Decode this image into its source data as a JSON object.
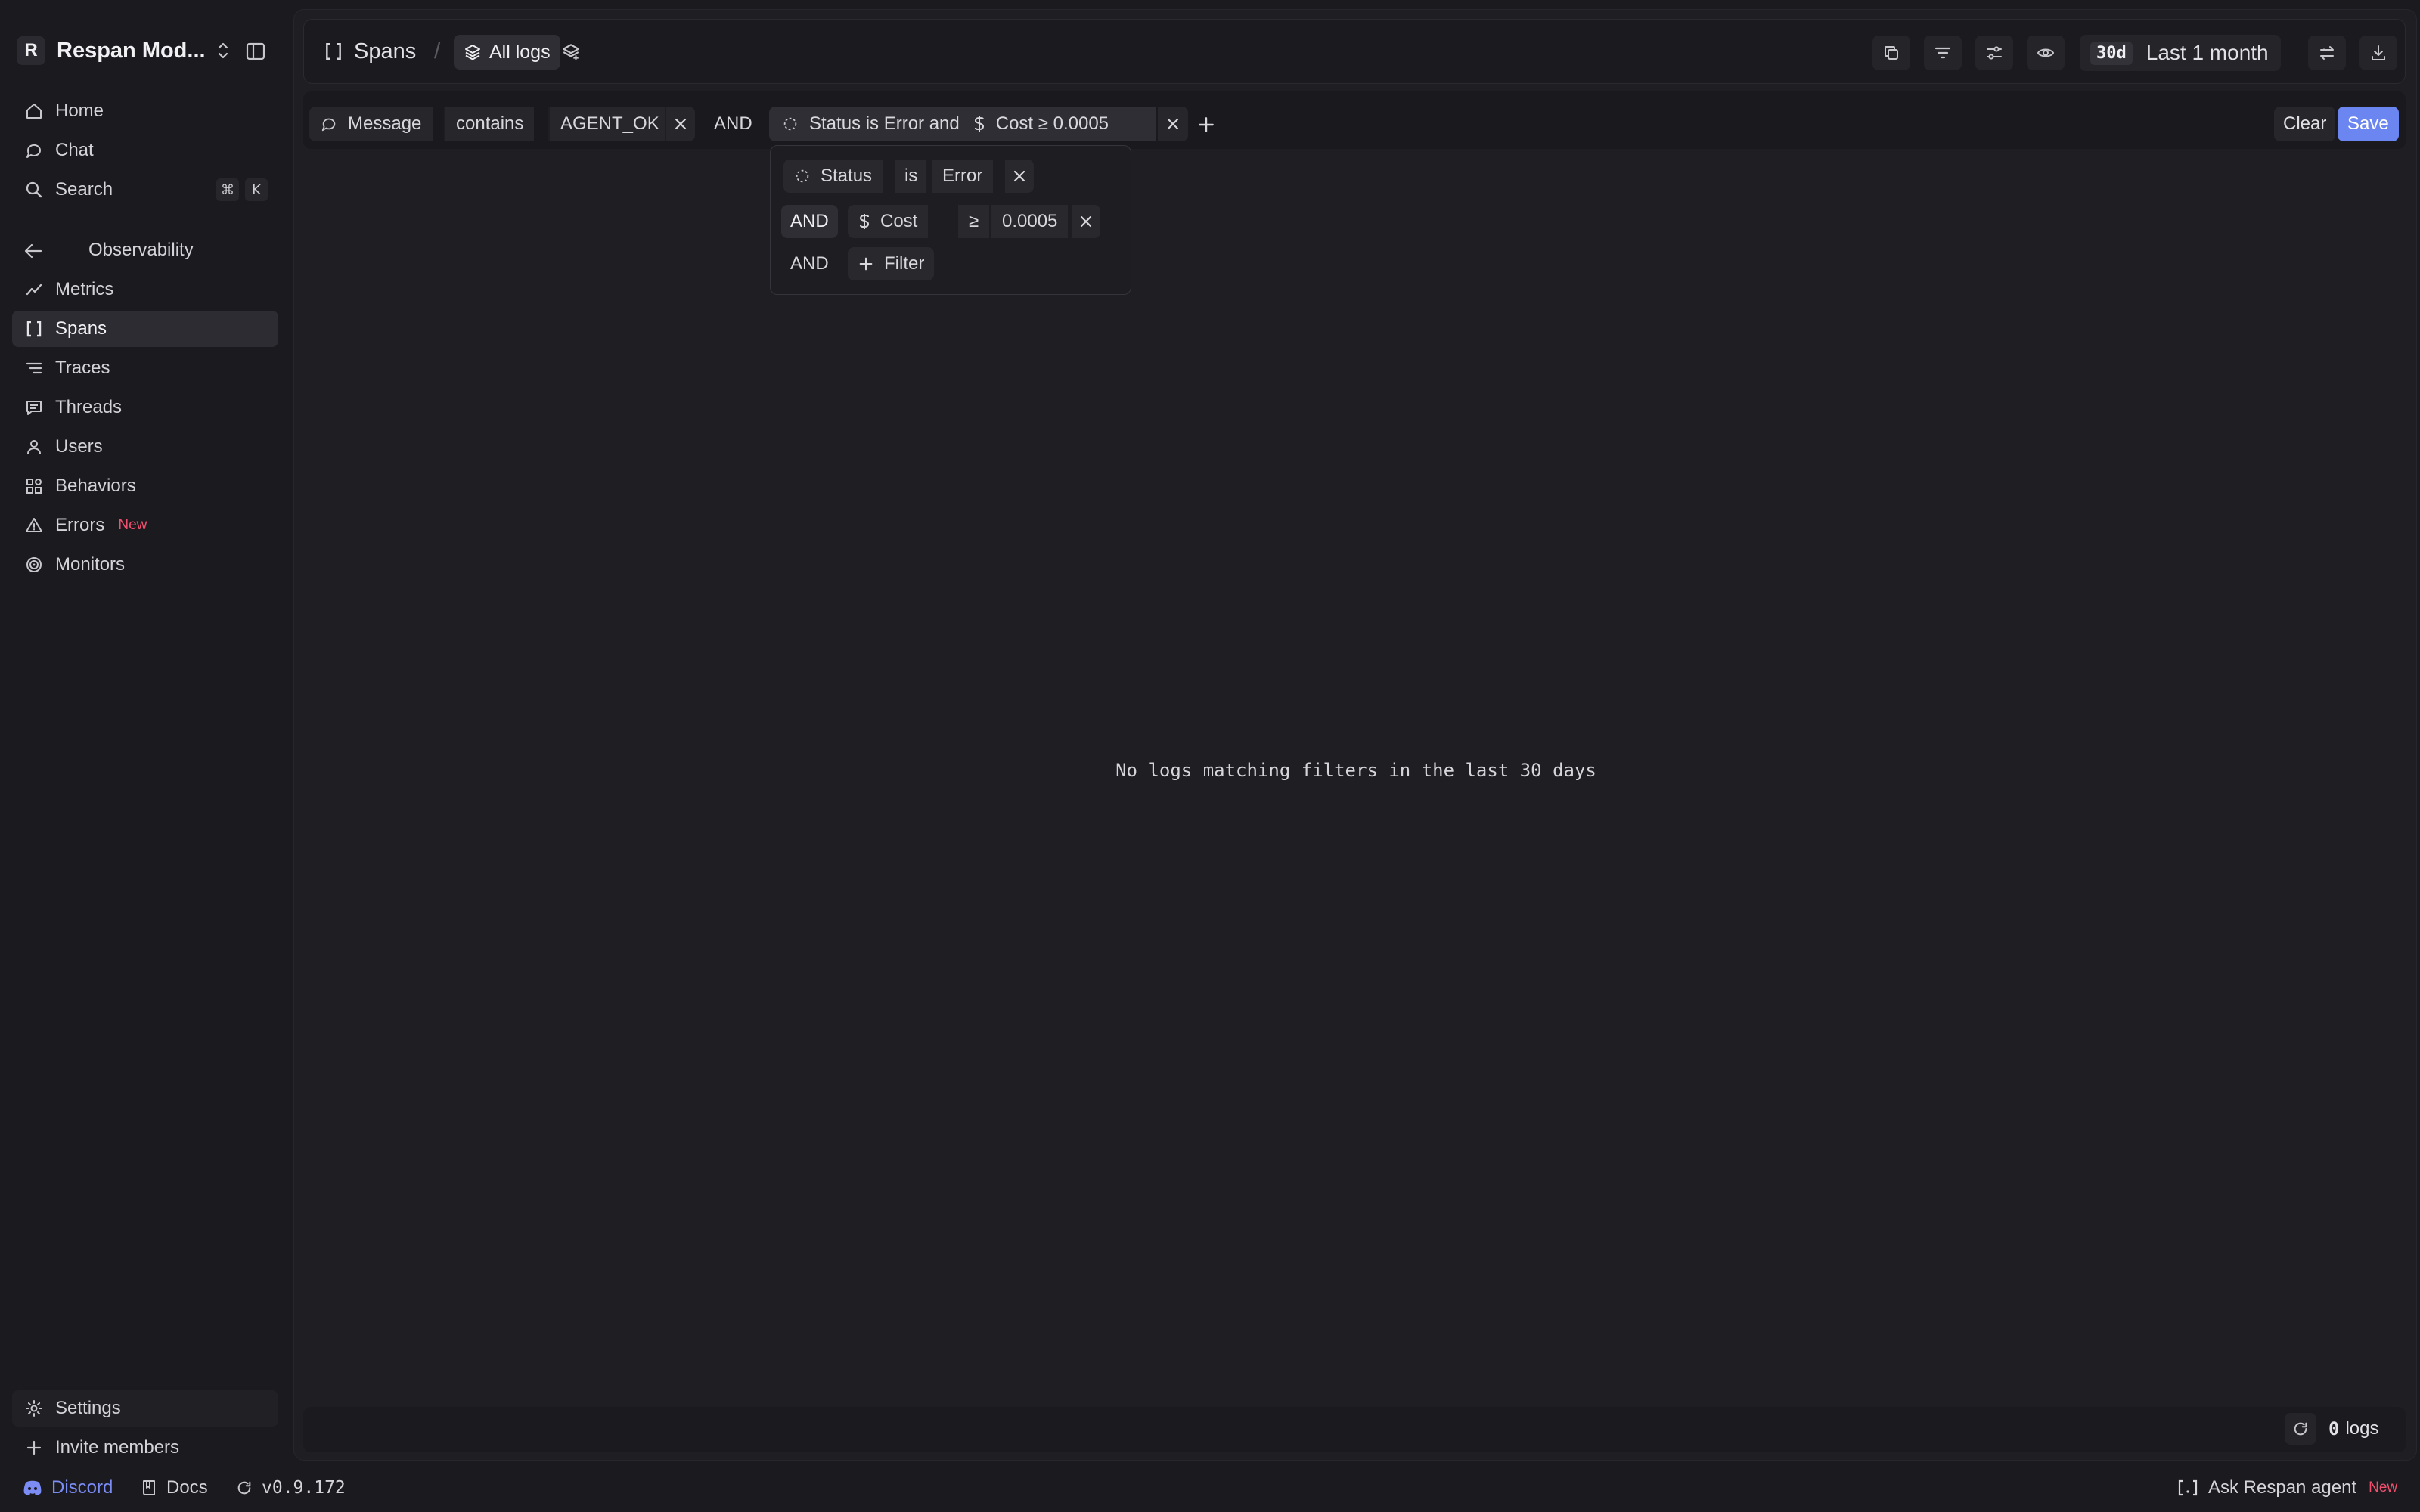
{
  "workspace": {
    "logo_letter": "R",
    "name": "Respan Mod..."
  },
  "nav_top": [
    {
      "label": "Home",
      "icon": "home-icon"
    },
    {
      "label": "Chat",
      "icon": "chat-icon"
    },
    {
      "label": "Search",
      "icon": "search-icon",
      "shortcut": [
        "⌘",
        "K"
      ]
    }
  ],
  "section": {
    "label": "Observability"
  },
  "nav_section": [
    {
      "label": "Metrics",
      "icon": "metrics-icon"
    },
    {
      "label": "Spans",
      "icon": "brackets-icon",
      "active": true
    },
    {
      "label": "Traces",
      "icon": "traces-icon"
    },
    {
      "label": "Threads",
      "icon": "threads-icon"
    },
    {
      "label": "Users",
      "icon": "user-icon"
    },
    {
      "label": "Behaviors",
      "icon": "behaviors-icon"
    },
    {
      "label": "Errors",
      "icon": "warning-icon",
      "badge": "New"
    },
    {
      "label": "Monitors",
      "icon": "monitors-icon"
    }
  ],
  "nav_bottom": [
    {
      "label": "Settings",
      "icon": "gear-icon"
    },
    {
      "label": "Invite members",
      "icon": "plus-icon"
    }
  ],
  "breadcrumb": {
    "section": "Spans",
    "separator": "/",
    "view": "All logs"
  },
  "time_range": {
    "badge": "30d",
    "label": "Last 1 month"
  },
  "filters": {
    "first": {
      "field": "Message",
      "operator": "contains",
      "value": "AGENT_OK"
    },
    "joiner": "AND",
    "group": {
      "part1": "Status is Error and",
      "part2": "Cost ≥ 0.0005"
    },
    "clear_label": "Clear",
    "save_label": "Save"
  },
  "popover": {
    "rows": [
      {
        "field": "Status",
        "operator": "is",
        "value": "Error"
      },
      {
        "joiner": "AND",
        "field": "Cost",
        "operator": "≥",
        "value": "0.0005"
      }
    ],
    "add_joiner": "AND",
    "add_label": "Filter"
  },
  "empty_message": "No logs matching filters in the last 30 days",
  "footer": {
    "count": "0",
    "unit": "logs"
  },
  "statusbar": {
    "discord": "Discord",
    "docs": "Docs",
    "version": "v0.9.172",
    "agent": "Ask Respan agent",
    "agent_badge": "New"
  },
  "colors": {
    "accent": "#6b86f0",
    "badge_new": "#f0506e",
    "background": "#1b1b1f",
    "discord": "#7c8cf5"
  }
}
